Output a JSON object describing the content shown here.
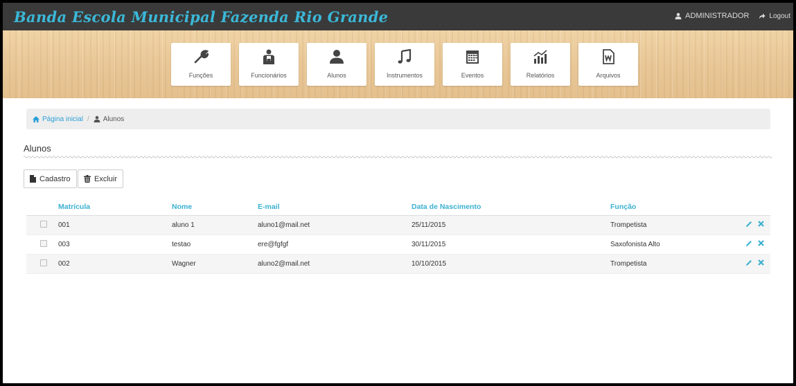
{
  "header": {
    "brand": "Banda Escola Municipal Fazenda Rio Grande",
    "user": "ADMINISTRADOR",
    "logout": "Logout"
  },
  "menu": [
    {
      "label": "Funções",
      "icon": "wrench-icon"
    },
    {
      "label": "Funcionários",
      "icon": "employees-icon"
    },
    {
      "label": "Alunos",
      "icon": "user-icon"
    },
    {
      "label": "Instrumentos",
      "icon": "music-note-icon"
    },
    {
      "label": "Eventos",
      "icon": "calendar-icon"
    },
    {
      "label": "Relatórios",
      "icon": "chart-icon"
    },
    {
      "label": "Arquivos",
      "icon": "word-file-icon"
    }
  ],
  "breadcrumb": {
    "home": "Página inicial",
    "separator": "/",
    "current": "Alunos"
  },
  "page": {
    "title": "Alunos",
    "add_label": "Cadastro",
    "delete_label": "Excluir"
  },
  "table": {
    "headers": [
      "Matrícula",
      "Nome",
      "E-mail",
      "Data de Nascimento",
      "Função"
    ],
    "rows": [
      {
        "matricula": "001",
        "nome": "aluno 1",
        "email": "aluno1@mail.net",
        "nascimento": "25/11/2015",
        "funcao": "Trompetista"
      },
      {
        "matricula": "003",
        "nome": "testao",
        "email": "ere@fgfgf",
        "nascimento": "30/11/2015",
        "funcao": "Saxofonista Alto"
      },
      {
        "matricula": "002",
        "nome": "Wagner",
        "email": "aluno2@mail.net",
        "nascimento": "10/10/2015",
        "funcao": "Trompetista"
      }
    ]
  },
  "colors": {
    "accent": "#3bb0d0",
    "topbar": "#3a3a3a",
    "link": "#2a9fd6"
  }
}
